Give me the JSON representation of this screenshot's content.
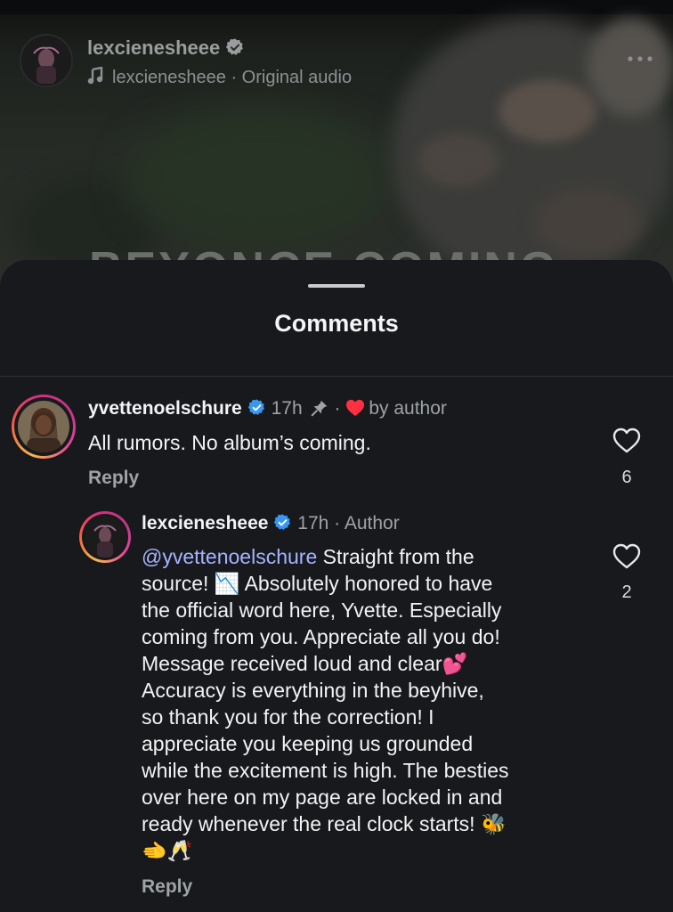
{
  "reel": {
    "username": "lexcienesheee",
    "audio_owner": "lexcienesheee",
    "audio_separator": "·",
    "audio_label": "Original audio",
    "overlay_text": "BEYONCE COMING"
  },
  "sheet": {
    "title": "Comments"
  },
  "comments": [
    {
      "username": "yvettenoelschure",
      "verified": true,
      "time": "17h",
      "pinned": true,
      "separator": "·",
      "liked_by_label": "by author",
      "text": "All rumors.  No album’s coming.",
      "reply_label": "Reply",
      "like_count": "6"
    },
    {
      "username": "lexcienesheee",
      "verified": true,
      "time": "17h",
      "author_badge": "· Author",
      "mention": "@yvettenoelschure",
      "lines": [
        " Straight from the",
        "source! 📉 Absolutely honored to have",
        "the official word here, Yvette. Especially",
        "coming from you. Appreciate all you do!",
        "Message received loud and clear💕",
        "Accuracy is everything in the beyhive,",
        "so thank you for the correction! I",
        "appreciate you keeping us grounded",
        "while the excitement is high. The besties",
        "over here on my page are locked in and",
        "ready whenever the real clock starts! 🐝",
        "🫲🥂"
      ],
      "reply_label": "Reply",
      "like_count": "2"
    }
  ],
  "icons": {
    "verified_color": "#3897f0",
    "heart_red": "#ff3040",
    "outline": "#e6e7e9"
  }
}
